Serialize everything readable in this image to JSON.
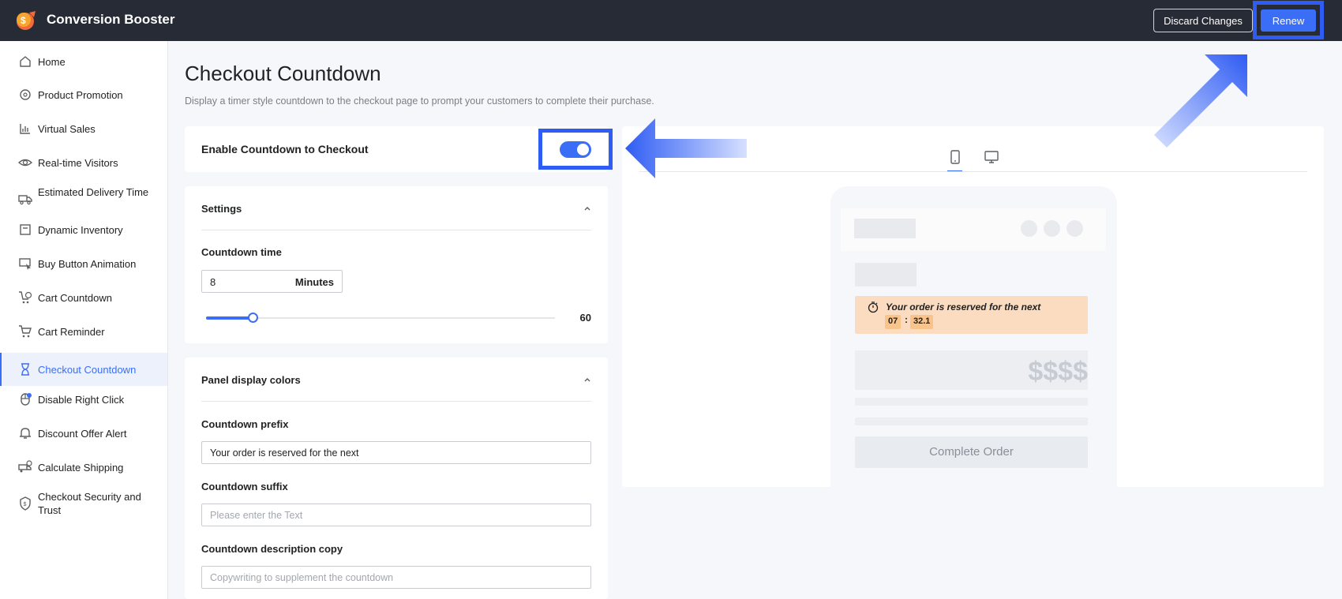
{
  "app": {
    "title": "Conversion Booster"
  },
  "header": {
    "discard_label": "Discard Changes",
    "renew_label": "Renew"
  },
  "sidebar": {
    "items": [
      {
        "label": "Home",
        "icon": "home-icon"
      },
      {
        "label": "Product Promotion",
        "icon": "badge-icon"
      },
      {
        "label": "Virtual Sales",
        "icon": "bar-chart-icon"
      },
      {
        "label": "Real-time Visitors",
        "icon": "eye-icon"
      },
      {
        "label": "Estimated Delivery Time",
        "icon": "truck-icon"
      },
      {
        "label": "Dynamic Inventory",
        "icon": "inventory-icon"
      },
      {
        "label": "Buy Button Animation",
        "icon": "cursor-icon"
      },
      {
        "label": "Cart Countdown",
        "icon": "cart-clock-icon"
      },
      {
        "label": "Cart Reminder",
        "icon": "cart-icon"
      },
      {
        "label": "Checkout Countdown",
        "icon": "hourglass-icon",
        "active": true
      },
      {
        "label": "Disable Right Click",
        "icon": "mouse-icon"
      },
      {
        "label": "Discount Offer Alert",
        "icon": "bell-icon"
      },
      {
        "label": "Calculate Shipping",
        "icon": "shipping-icon"
      },
      {
        "label": "Checkout Security and Trust",
        "icon": "shield-icon"
      }
    ]
  },
  "main": {
    "title": "Checkout Countdown",
    "description": "Display a timer style countdown to the checkout page to prompt your customers to complete their purchase.",
    "enable_label": "Enable Countdown to Checkout",
    "enabled": true,
    "settings": {
      "heading": "Settings",
      "countdown_time_label": "Countdown time",
      "countdown_value": "8",
      "countdown_unit": "Minutes",
      "slider_value": 8,
      "slider_max": "60"
    },
    "colors": {
      "heading": "Panel display colors",
      "prefix_label": "Countdown prefix",
      "prefix_value": "Your order is reserved for the next",
      "suffix_label": "Countdown suffix",
      "suffix_placeholder": "Please enter the Text",
      "description_label": "Countdown description copy",
      "description_placeholder": "Copywriting to supplement the countdown"
    }
  },
  "preview": {
    "tabs": [
      "mobile-icon",
      "desktop-icon"
    ],
    "banner_text": "Your order is reserved for the next",
    "timer_minutes": "07",
    "timer_separator": ":",
    "timer_seconds": "32.1",
    "price": "$$$$",
    "button_label": "Complete Order"
  },
  "colors": {
    "accent": "#3b6ef6",
    "topbar": "#262b35",
    "banner": "#fcdcc0",
    "highlight": "#2f5cf3"
  }
}
